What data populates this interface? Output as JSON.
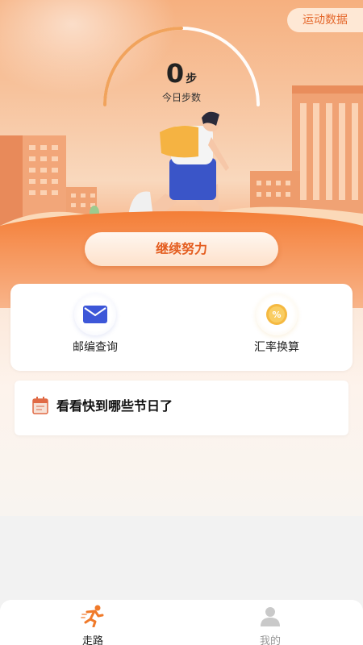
{
  "header": {
    "data_button": "运动数据"
  },
  "steps": {
    "value": "0",
    "unit": "步",
    "label": "今日步数",
    "progress": 0
  },
  "main": {
    "continue_button": "继续努力"
  },
  "tools": [
    {
      "label": "邮编查询",
      "icon": "envelope-icon"
    },
    {
      "label": "汇率换算",
      "icon": "percent-coin-icon"
    }
  ],
  "holiday": {
    "text": "看看快到哪些节日了",
    "icon": "calendar-icon"
  },
  "tabbar": {
    "tabs": [
      {
        "label": "走路",
        "icon": "running-icon",
        "active": true
      },
      {
        "label": "我的",
        "icon": "user-icon",
        "active": false
      }
    ]
  },
  "colors": {
    "accent": "#e4672a",
    "tab_active": "#222222",
    "tab_inactive": "#999999"
  }
}
